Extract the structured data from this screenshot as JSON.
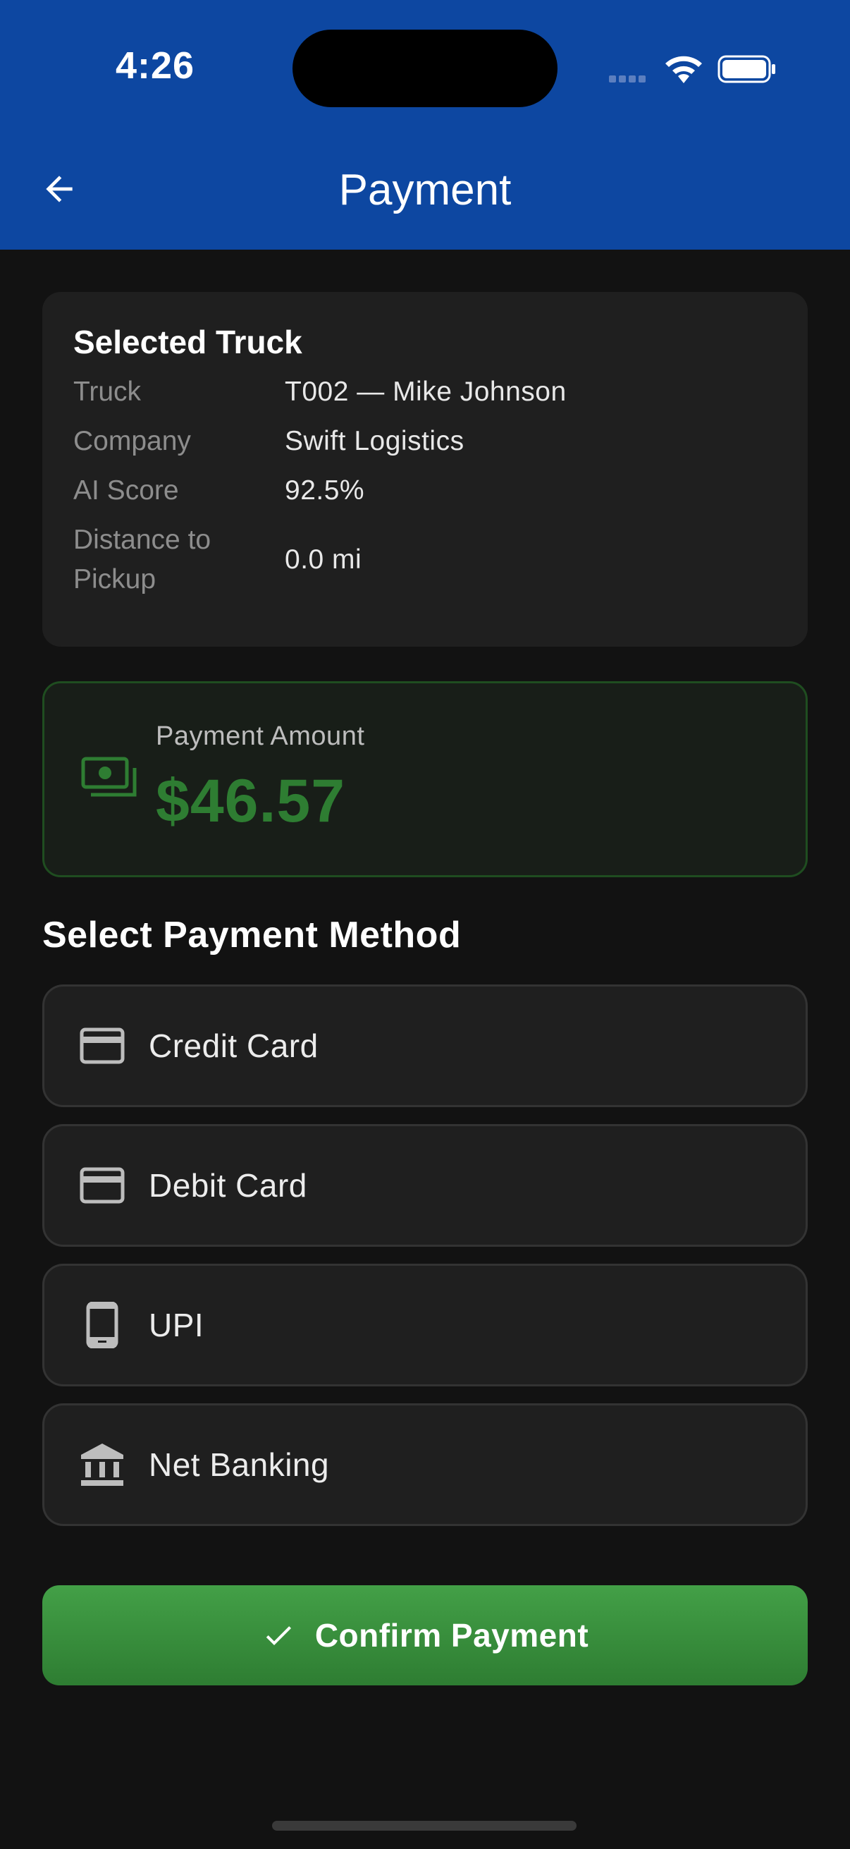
{
  "status_bar": {
    "time": "4:26"
  },
  "header": {
    "title": "Payment"
  },
  "truck_card": {
    "title": "Selected Truck",
    "rows": [
      {
        "label": "Truck",
        "value": "T002 — Mike Johnson"
      },
      {
        "label": "Company",
        "value": "Swift Logistics"
      },
      {
        "label": "AI Score",
        "value": "92.5%"
      },
      {
        "label": "Distance to Pickup",
        "value": "0.0 mi"
      }
    ]
  },
  "amount": {
    "label": "Payment Amount",
    "value": "$46.57"
  },
  "methods": {
    "title": "Select Payment Method",
    "items": [
      {
        "label": "Credit Card",
        "icon": "credit-card-icon"
      },
      {
        "label": "Debit Card",
        "icon": "debit-card-icon"
      },
      {
        "label": "UPI",
        "icon": "phone-icon"
      },
      {
        "label": "Net Banking",
        "icon": "bank-icon"
      }
    ]
  },
  "confirm": {
    "label": "Confirm Payment"
  },
  "colors": {
    "header": "#0d47a1",
    "background": "#121212",
    "accent_green": "#2e7d32"
  }
}
